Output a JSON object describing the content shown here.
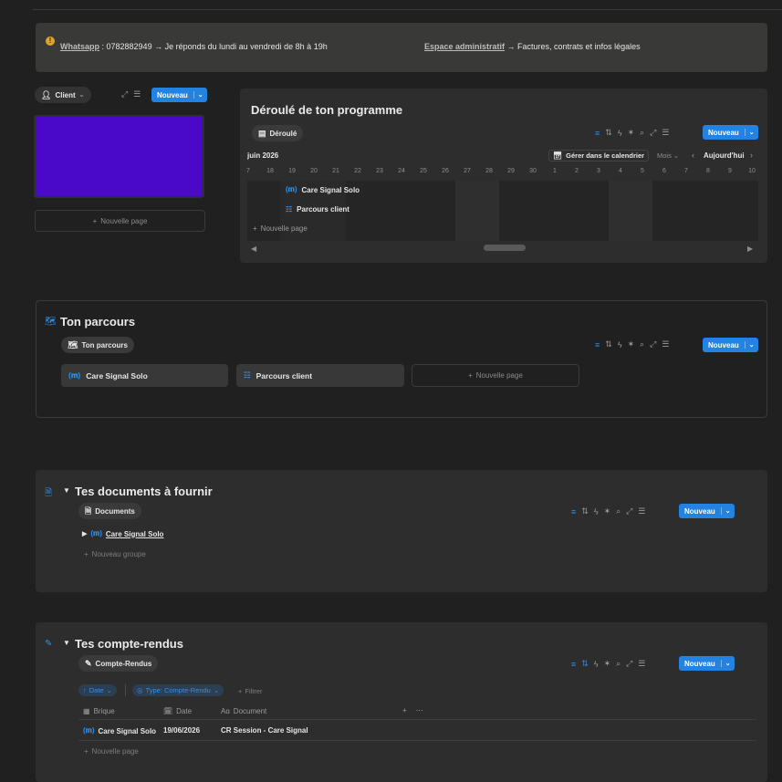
{
  "callout": {
    "whatsapp_label": "Whatsapp",
    "whatsapp_text": " : 0782882949 → Je réponds du lundi au vendredi de 8h à 19h",
    "admin_label": "Espace administratif",
    "admin_text": " → Factures, contrats et infos légales"
  },
  "left_gallery": {
    "filter_label": "Client",
    "new_label": "Nouveau",
    "new_page_label": "Nouvelle page",
    "card_color": "#4a08c9"
  },
  "timeline": {
    "title": "Déroulé de ton programme",
    "view_label": "Déroulé",
    "new_label": "Nouveau",
    "month": "juin 2026",
    "calendar_label": "Gérer dans le calendrier",
    "zoom_label": "Mois",
    "today_label": "Aujourd'hui",
    "days": [
      "7",
      "18",
      "19",
      "20",
      "21",
      "22",
      "23",
      "24",
      "25",
      "26",
      "27",
      "28",
      "29",
      "30",
      "1",
      "2",
      "3",
      "4",
      "5",
      "6",
      "7",
      "8",
      "9",
      "10"
    ],
    "items": [
      "Care Signal Solo",
      "Parcours client"
    ],
    "new_page_label": "Nouvelle page"
  },
  "parcours": {
    "title": "Ton parcours",
    "view_label": "Ton parcours",
    "new_label": "Nouveau",
    "cards": [
      "Care Signal Solo",
      "Parcours client"
    ],
    "new_page_label": "Nouvelle page"
  },
  "documents": {
    "title": "Tes documents à fournir",
    "view_label": "Documents",
    "new_label": "Nouveau",
    "group": "Care Signal Solo",
    "new_group_label": "Nouveau groupe"
  },
  "comptes": {
    "title": "Tes compte-rendus",
    "view_label": "Compte-Rendus",
    "new_label": "Nouveau",
    "sort_chip": "Date",
    "type_chip": "Type: Compte-Rendu",
    "filter_label": "Filtrer",
    "columns": [
      "Brique",
      "Date",
      "Document"
    ],
    "row": {
      "brique": "Care Signal Solo",
      "date": "19/06/2026",
      "document": "CR Session - Care Signal"
    },
    "new_page_label": "Nouvelle page"
  },
  "colors": {
    "accent": "#2383e2",
    "warning": "#e0a42a"
  }
}
